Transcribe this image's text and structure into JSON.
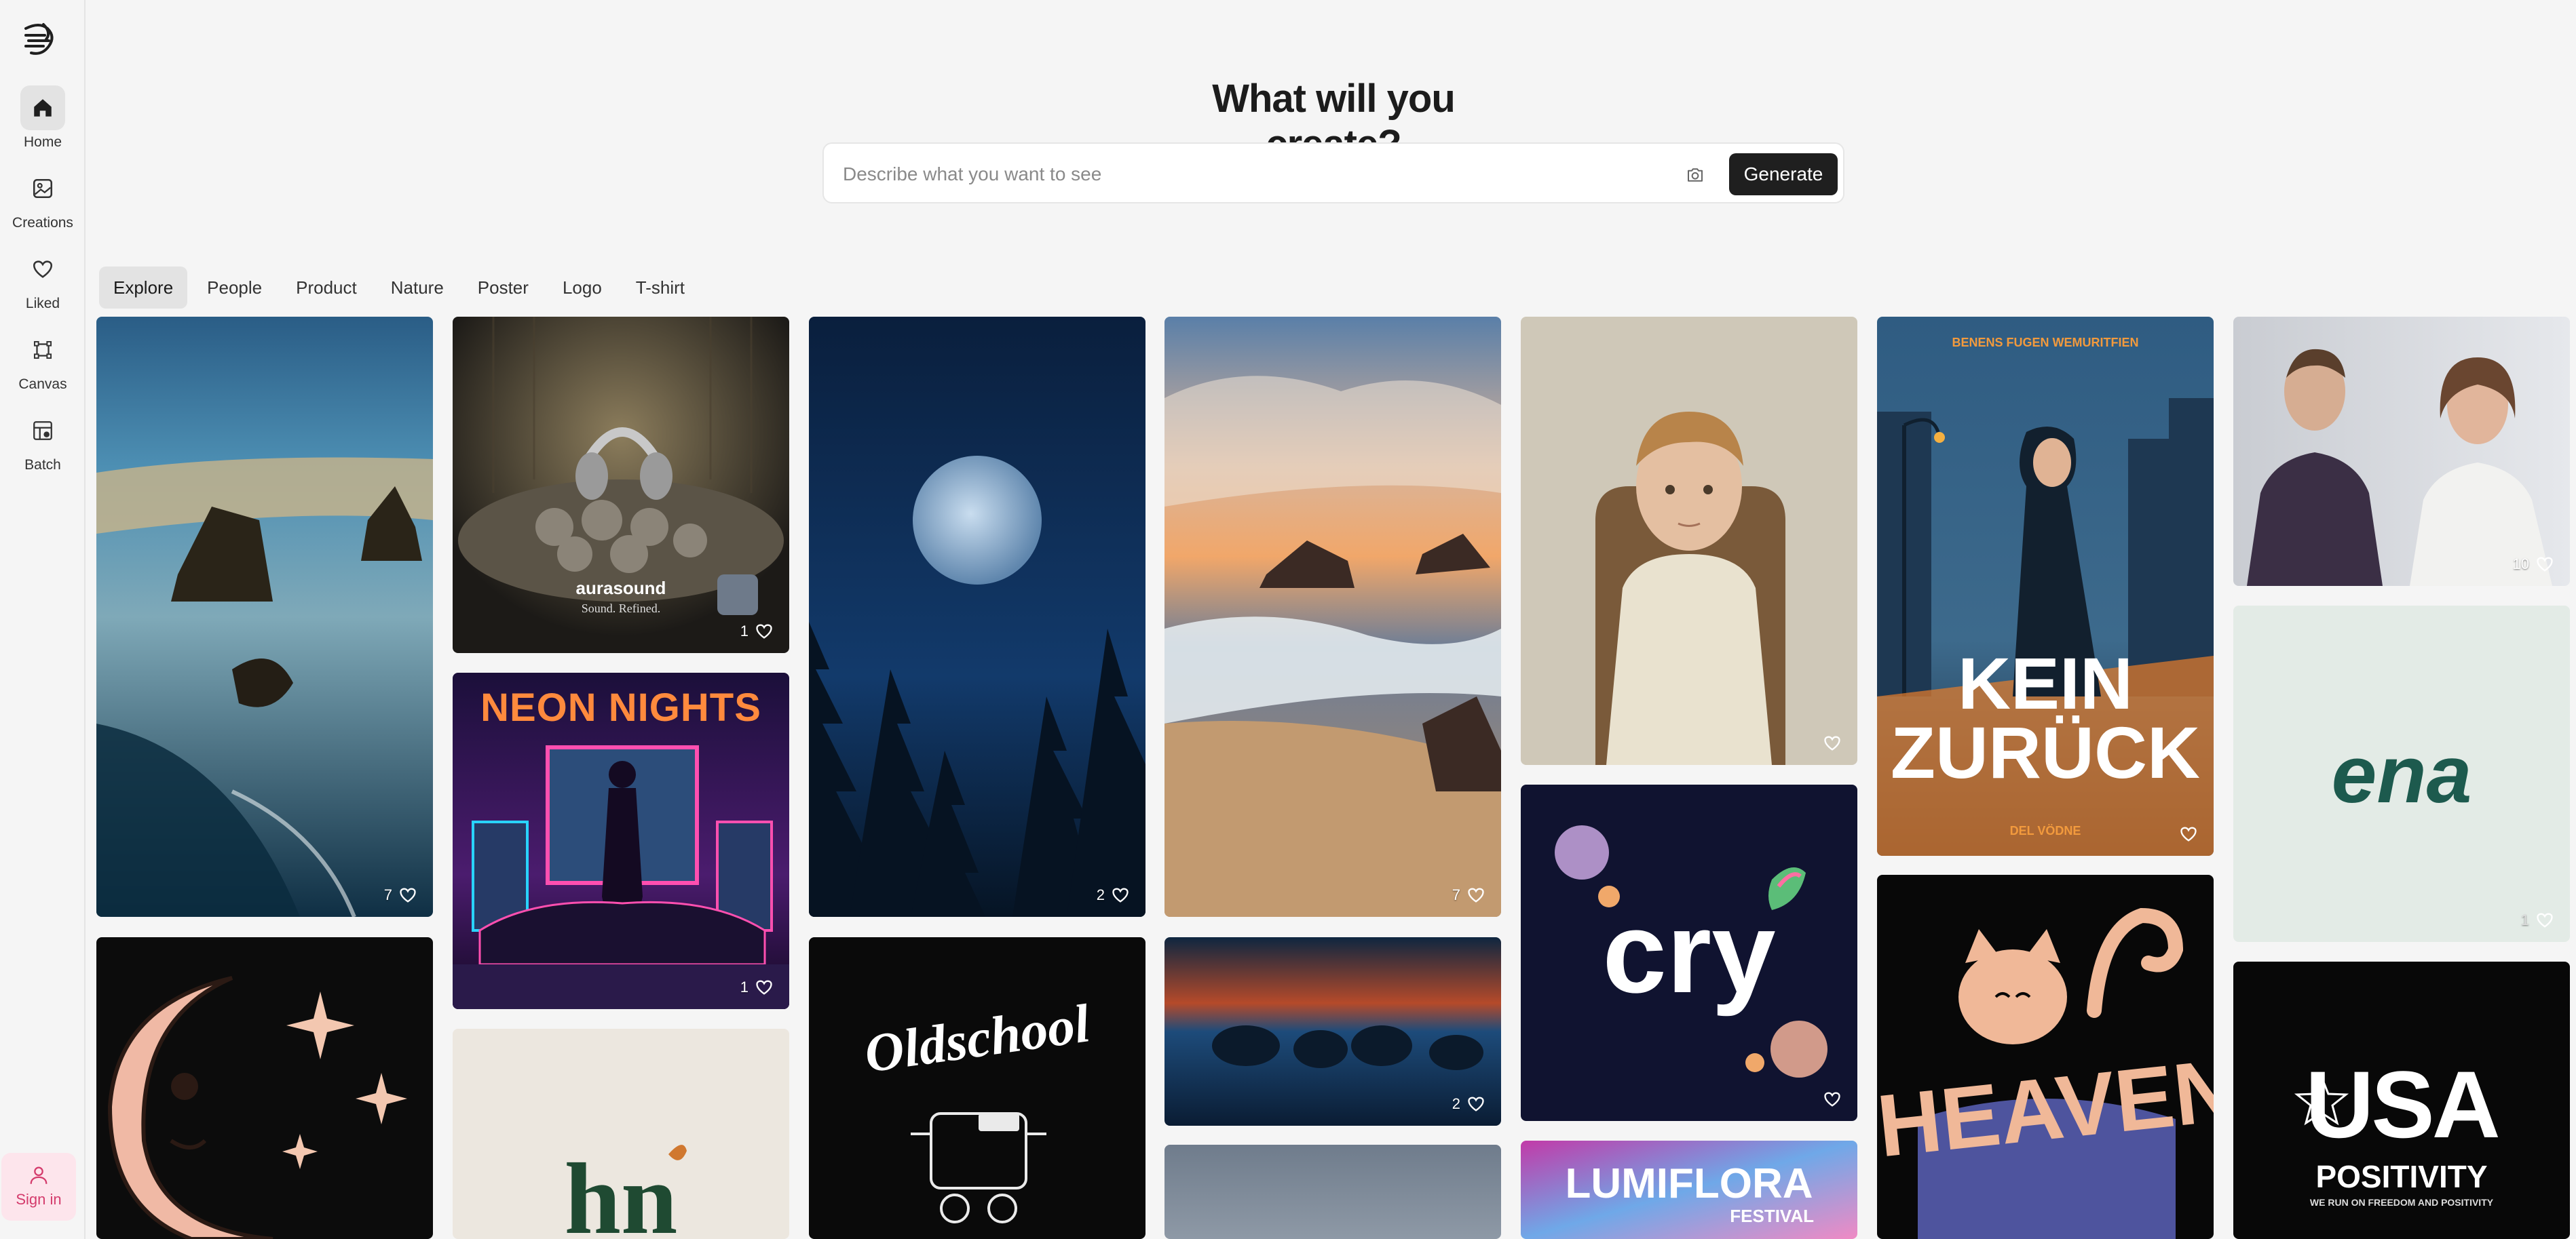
{
  "sidebar": {
    "items": [
      {
        "label": "Home",
        "icon": "home-icon",
        "active": true
      },
      {
        "label": "Creations",
        "icon": "image-icon",
        "active": false
      },
      {
        "label": "Liked",
        "icon": "heart-icon",
        "active": false
      },
      {
        "label": "Canvas",
        "icon": "canvas-icon",
        "active": false
      },
      {
        "label": "Batch",
        "icon": "batch-icon",
        "active": false
      }
    ],
    "signin_label": "Sign in"
  },
  "header": {
    "title": "What will you create?",
    "search_placeholder": "Describe what you want to see",
    "generate_label": "Generate"
  },
  "tabs": [
    "Explore",
    "People",
    "Product",
    "Nature",
    "Poster",
    "Logo",
    "T-shirt"
  ],
  "gallery": {
    "cards": [
      {
        "id": "coast-rocks",
        "likes": "7"
      },
      {
        "id": "aurasound",
        "likes": "1",
        "text1": "aurasound",
        "text2": "Sound. Refined."
      },
      {
        "id": "neon-nights",
        "likes": "1",
        "text1": "NEON NIGHTS"
      },
      {
        "id": "moon-forest",
        "likes": "2"
      },
      {
        "id": "sunset-waves",
        "likes": "7"
      },
      {
        "id": "boy-portrait",
        "likes": ""
      },
      {
        "id": "kein-zurueck",
        "likes": "",
        "text1": "BENENS FUGEN WEMURITFIEN",
        "text2": "KEIN",
        "text3": "ZURÜCK",
        "text4": "DEL VÖDNE"
      },
      {
        "id": "sweatshirts",
        "likes": "10"
      },
      {
        "id": "ena-logo",
        "likes": "1",
        "text1": "ena"
      },
      {
        "id": "cry-logo",
        "likes": "",
        "text1": "cry"
      },
      {
        "id": "night-beach",
        "likes": "2"
      },
      {
        "id": "oldschool",
        "likes": "",
        "text1": "Oldschool"
      },
      {
        "id": "moon-face",
        "likes": ""
      },
      {
        "id": "hn-logo",
        "likes": "",
        "text1": "hn"
      },
      {
        "id": "heaven-cat",
        "likes": "",
        "text1": "HEAVEN"
      },
      {
        "id": "usa-positivity",
        "likes": "",
        "text1": "USA",
        "text2": "POSITIVITY",
        "text3": "WE RUN ON FREEDOM AND POSITIVITY"
      },
      {
        "id": "lumiflora",
        "likes": "",
        "text1": "LUMIFLORA",
        "text2": "FESTIVAL"
      },
      {
        "id": "grey-sky",
        "likes": ""
      }
    ]
  },
  "colors": {
    "accent_signin": "#d43b6c",
    "generate_bg": "#1f1f1f"
  }
}
